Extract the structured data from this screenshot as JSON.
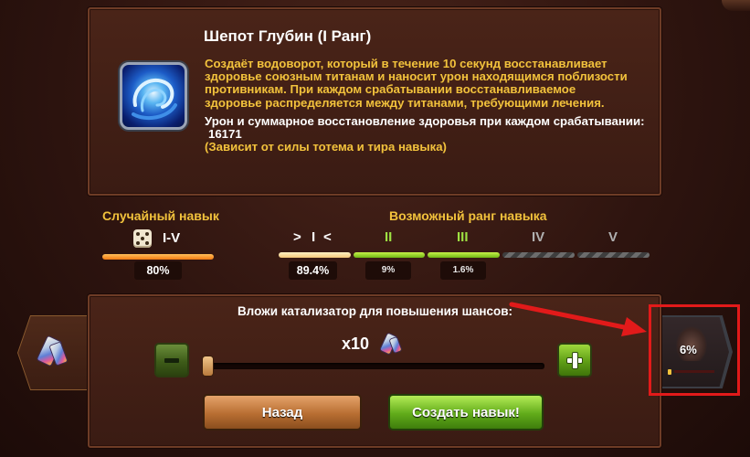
{
  "skill": {
    "title": "Шепот Глубин (I Ранг)",
    "description": "Создаёт водоворот, который в течение 10 секунд восстанавливает здоровье союзным титанам и наносит урон находящимся поблизости противникам. При каждом срабатывании восстанавливаемое здоровье распределяется между титанами, требующими лечения.",
    "stat_label": "Урон и суммарное восстановление здоровья при каждом срабатывании:",
    "stat_value": "16171",
    "note": "(Зависит от силы тотема и тира навыка)",
    "icon": "whirlpool-skill-icon"
  },
  "random_skill": {
    "label": "Случайный навык",
    "range": "I-V",
    "percent": "80%",
    "icon": "dice-icon"
  },
  "possible_rank": {
    "label": "Возможный ранг навыка",
    "ranks": [
      {
        "name": "I",
        "percent": "89.4%",
        "state": "current"
      },
      {
        "name": "II",
        "percent": "9%",
        "state": "available"
      },
      {
        "name": "III",
        "percent": "1.6%",
        "state": "available"
      },
      {
        "name": "IV",
        "percent": "",
        "state": "locked"
      },
      {
        "name": "V",
        "percent": "",
        "state": "locked"
      }
    ]
  },
  "catalyst": {
    "title": "Вложи катализатор для повышения шансов:",
    "count": "x10",
    "slider_fraction": 0,
    "icon": "catalyst-crystal-icon"
  },
  "buttons": {
    "back": "Назад",
    "create": "Создать навык!"
  },
  "totem": {
    "percent": "6%"
  },
  "colors": {
    "accent_yellow": "#f2c23c",
    "green": "#6fb614",
    "orange": "#f27a12",
    "annotation_red": "#e21a1a"
  }
}
